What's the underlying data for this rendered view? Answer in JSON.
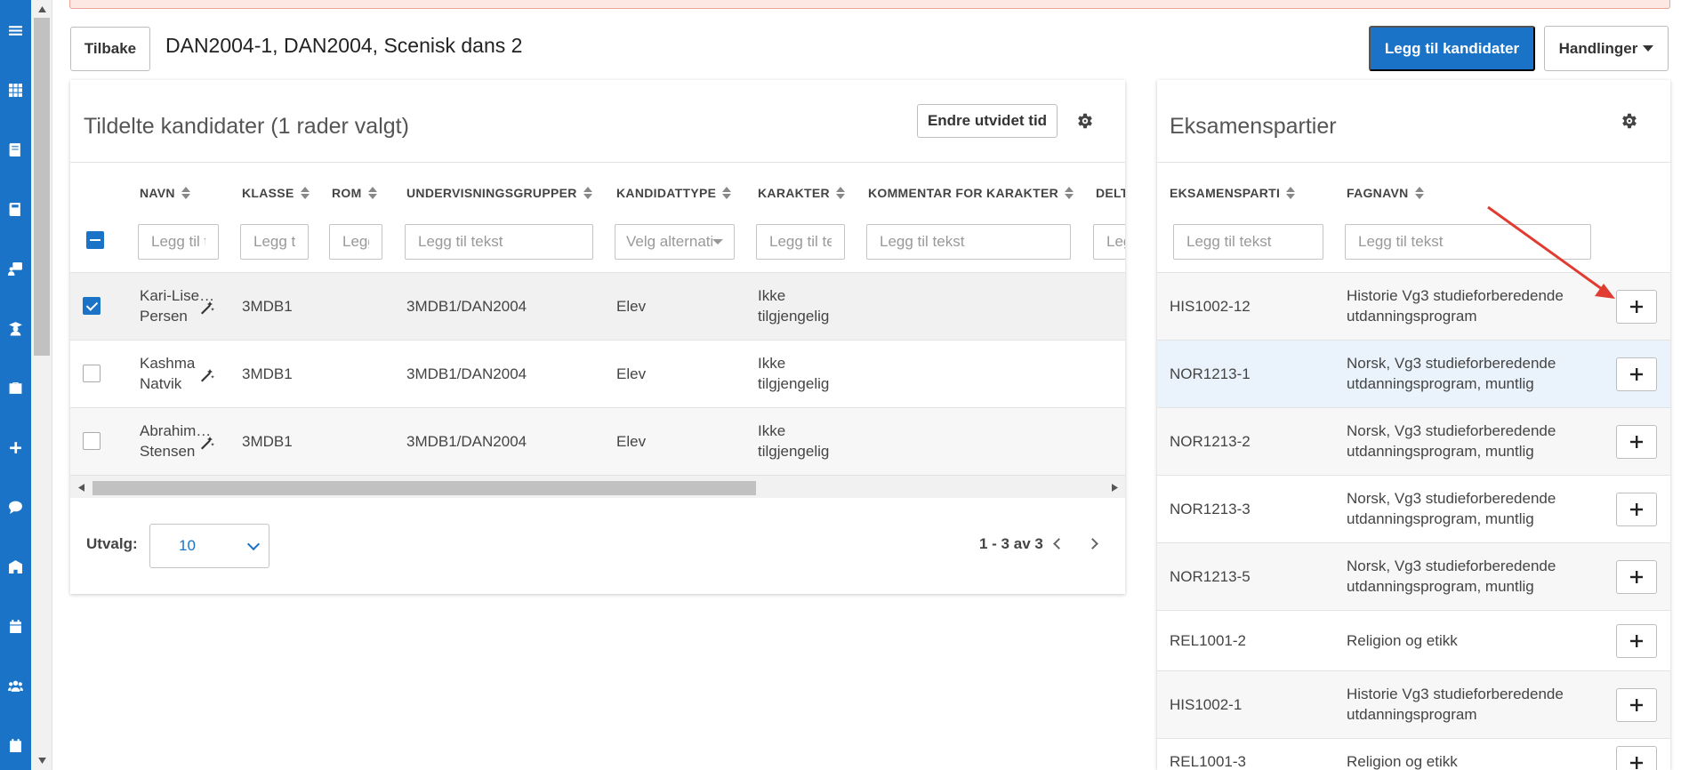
{
  "header": {
    "back_label": "Tilbake",
    "title": "DAN2004-1, DAN2004, Scenisk dans 2",
    "add_candidates_label": "Legg til kandidater",
    "actions_label": "Handlinger"
  },
  "left_panel": {
    "title": "Tildelte kandidater (1 rader valgt)",
    "extend_time_label": "Endre utvidet tid",
    "columns": [
      "NAVN",
      "KLASSE",
      "ROM",
      "UNDERVISNINGSGRUPPER",
      "KANDIDATTYPE",
      "KARAKTER",
      "KOMMENTAR FOR KARAKTER",
      "DELT"
    ],
    "filters": {
      "navn": "Legg til tekst",
      "klasse": "Legg til tekst",
      "rom": "Legg til tekst",
      "grupper": "Legg til tekst",
      "kandidattype": "Velg alternativ",
      "karakter": "Legg til tekst",
      "kommentar": "Legg til tekst",
      "delt": "Legg til tekst"
    },
    "rows": [
      {
        "first": "Kari-Lise…",
        "last": "Persen",
        "klasse": "3MDB1",
        "rom": "",
        "gruppe": "3MDB1/DAN2004",
        "type": "Elev",
        "karakter_1": "Ikke",
        "karakter_2": "tilgjengelig",
        "checked": true
      },
      {
        "first": "Kashma",
        "last": "Natvik",
        "klasse": "3MDB1",
        "rom": "",
        "gruppe": "3MDB1/DAN2004",
        "type": "Elev",
        "karakter_1": "Ikke",
        "karakter_2": "tilgjengelig",
        "checked": false
      },
      {
        "first": "Abrahim…",
        "last": "Stensen",
        "klasse": "3MDB1",
        "rom": "",
        "gruppe": "3MDB1/DAN2004",
        "type": "Elev",
        "karakter_1": "Ikke",
        "karakter_2": "tilgjengelig",
        "checked": false
      }
    ],
    "footer": {
      "utvalg_label": "Utvalg:",
      "utvalg_value": "10",
      "pager_text": "1 - 3 av 3"
    }
  },
  "right_panel": {
    "title": "Eksamenspartier",
    "columns": [
      "EKSAMENSPARTI",
      "FAGNAVN"
    ],
    "filters": {
      "parti": "Legg til tekst",
      "fagnavn": "Legg til tekst"
    },
    "rows": [
      {
        "code": "HIS1002-12",
        "name_1": "Historie Vg3 studieforberedende",
        "name_2": "utdanningsprogram"
      },
      {
        "code": "NOR1213-1",
        "name_1": "Norsk, Vg3 studieforberedende",
        "name_2": "utdanningsprogram, muntlig"
      },
      {
        "code": "NOR1213-2",
        "name_1": "Norsk, Vg3 studieforberedende",
        "name_2": "utdanningsprogram, muntlig"
      },
      {
        "code": "NOR1213-3",
        "name_1": "Norsk, Vg3 studieforberedende",
        "name_2": "utdanningsprogram, muntlig"
      },
      {
        "code": "NOR1213-5",
        "name_1": "Norsk, Vg3 studieforberedende",
        "name_2": "utdanningsprogram, muntlig"
      },
      {
        "code": "REL1001-2",
        "name_1": "Religion og etikk",
        "name_2": ""
      },
      {
        "code": "HIS1002-1",
        "name_1": "Historie Vg3 studieforberedende",
        "name_2": "utdanningsprogram"
      },
      {
        "code": "REL1001-3",
        "name_1": "Religion og etikk",
        "name_2": ""
      }
    ]
  },
  "sidenav_icons": [
    "menu-icon",
    "apps-grid-icon",
    "book-icon",
    "book-alt-icon",
    "teacher-icon",
    "student-icon",
    "briefcase-icon",
    "plus-icon",
    "chat-icon",
    "school-icon",
    "calendar-icon",
    "group-icon",
    "calendar-check-icon"
  ],
  "colors": {
    "primary": "#1a73c7",
    "alert_bg": "#fde8e4",
    "annotation_arrow": "#e03c31"
  }
}
